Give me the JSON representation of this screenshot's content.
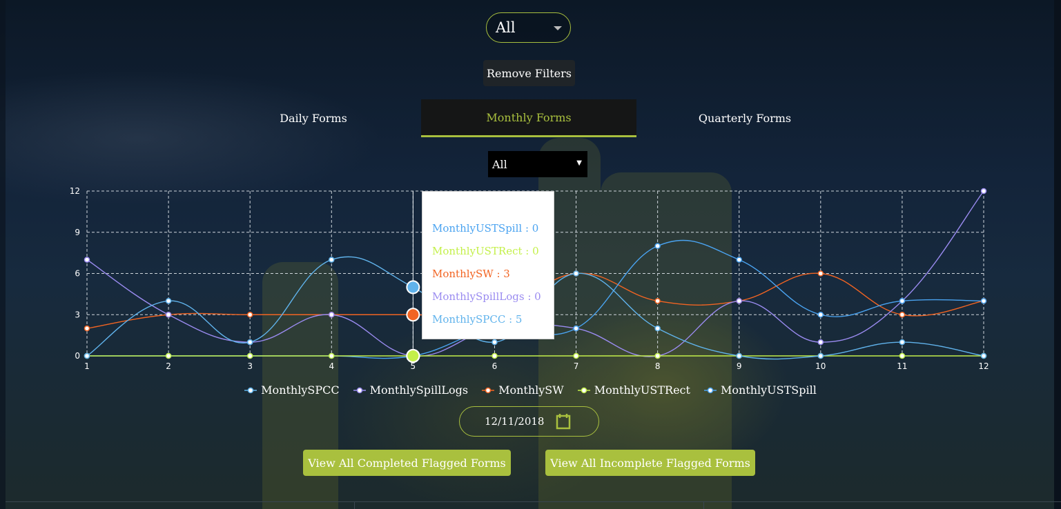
{
  "header": {
    "top_select_value": "All",
    "remove_filters_label": "Remove Filters"
  },
  "tabs": [
    {
      "label": "Daily Forms",
      "active": false
    },
    {
      "label": "Monthly Forms",
      "active": true
    },
    {
      "label": "Quarterly Forms",
      "active": false
    }
  ],
  "form_select_value": "All",
  "tooltip": {
    "x_value": 5,
    "rows": [
      {
        "label": "MonthlyUSTSpill : 0",
        "color": "#4aa3f0"
      },
      {
        "label": "MonthlyUSTRect : 0",
        "color": "#c4f04a"
      },
      {
        "label": "MonthlySW : 3",
        "color": "#f26422"
      },
      {
        "label": "MonthlySpillLogs : 0",
        "color": "#9a8bf0"
      },
      {
        "label": "MonthlySPCC : 5",
        "color": "#60b3ec"
      }
    ]
  },
  "date_value": "12/11/2018",
  "buttons": {
    "completed_label": "View All Completed Flagged Forms",
    "incomplete_label": "View All Incomplete Flagged Forms"
  },
  "colors": {
    "accent": "#a9c03e",
    "grid": "#cfd6dc"
  },
  "chart_data": {
    "type": "line",
    "x": [
      1,
      2,
      3,
      4,
      5,
      6,
      7,
      8,
      9,
      10,
      11,
      12
    ],
    "ylim": [
      0,
      12
    ],
    "yticks": [
      0,
      3,
      6,
      9,
      12
    ],
    "grid": true,
    "legend_position": "bottom",
    "series": [
      {
        "name": "MonthlySPCC",
        "color": "#60b3ec",
        "values": [
          0,
          4,
          1,
          7,
          5,
          1,
          6,
          2,
          0,
          0,
          1,
          0
        ]
      },
      {
        "name": "MonthlySpillLogs",
        "color": "#9a8bf0",
        "values": [
          7,
          3,
          1,
          3,
          0,
          2,
          2,
          0,
          4,
          1,
          4,
          12
        ]
      },
      {
        "name": "MonthlySW",
        "color": "#f26422",
        "values": [
          2,
          3,
          3,
          3,
          3,
          3,
          6,
          4,
          4,
          6,
          3,
          4
        ]
      },
      {
        "name": "MonthlyUSTRect",
        "color": "#c4f04a",
        "values": [
          0,
          0,
          0,
          0,
          0,
          0,
          0,
          0,
          0,
          0,
          0,
          0
        ]
      },
      {
        "name": "MonthlyUSTSpill",
        "color": "#4aa3f0",
        "values": [
          0,
          0,
          0,
          0,
          0,
          2,
          2,
          8,
          7,
          3,
          4,
          4
        ]
      }
    ]
  }
}
